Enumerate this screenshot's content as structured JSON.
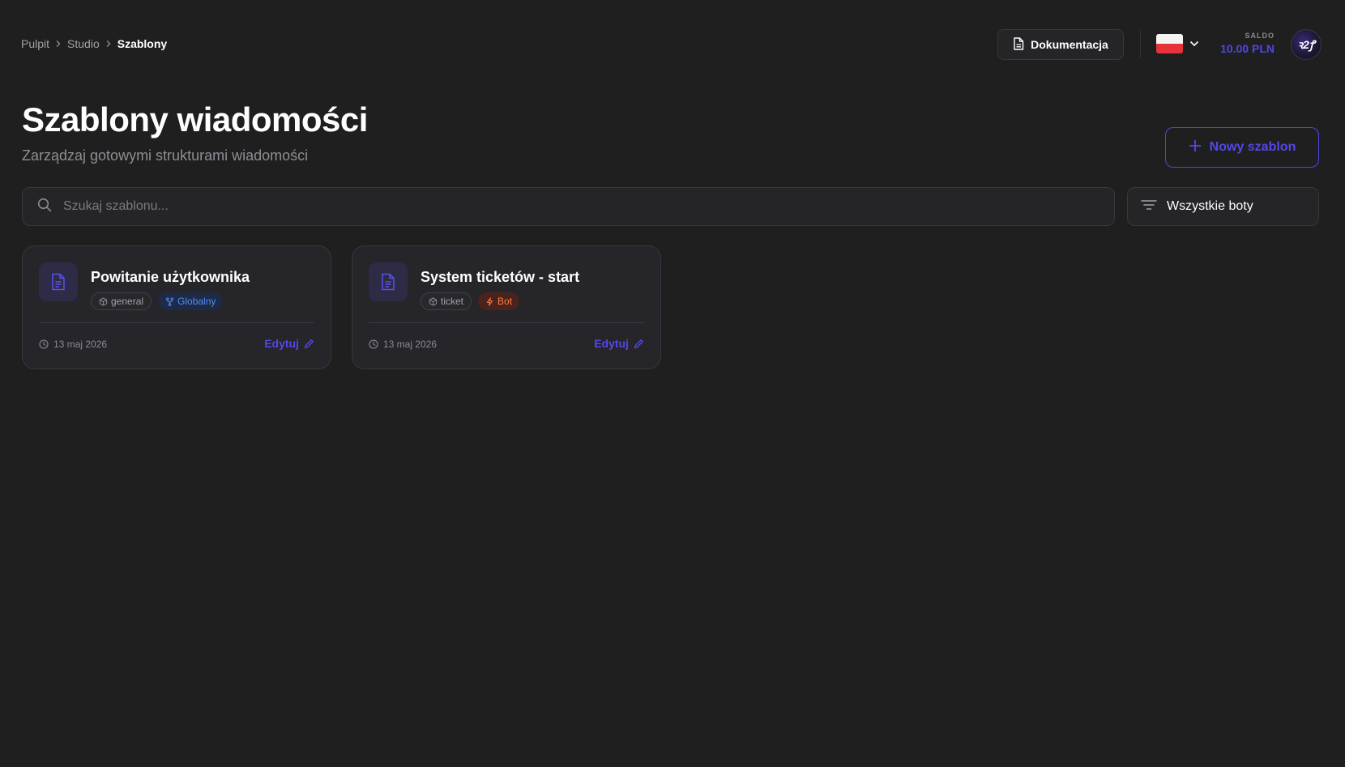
{
  "breadcrumb": {
    "items": [
      "Pulpit",
      "Studio"
    ],
    "current": "Szablony"
  },
  "header": {
    "docs_label": "Dokumentacja",
    "language": "pl",
    "balance_label": "SALDO",
    "balance_value": "10.00 PLN",
    "avatar_text": "ꝛ2ꝭ"
  },
  "page": {
    "title": "Szablony wiadomości",
    "subtitle": "Zarządzaj gotowymi strukturami wiadomości",
    "new_button_label": "Nowy szablon"
  },
  "search": {
    "placeholder": "Szukaj szablonu...",
    "value": ""
  },
  "filter": {
    "selected": "Wszystkie boty"
  },
  "templates": [
    {
      "title": "Powitanie użytkownika",
      "tags": [
        {
          "label": "general",
          "icon": "cube-icon",
          "style": "gray"
        },
        {
          "label": "Globalny",
          "icon": "branch-icon",
          "style": "blue"
        }
      ],
      "date": "13 maj 2026",
      "edit_label": "Edytuj"
    },
    {
      "title": "System ticketów - start",
      "tags": [
        {
          "label": "ticket",
          "icon": "cube-icon",
          "style": "gray"
        },
        {
          "label": "Bot",
          "icon": "bolt-icon",
          "style": "orange"
        }
      ],
      "date": "13 maj 2026",
      "edit_label": "Edytuj"
    }
  ],
  "colors": {
    "background": "#1f1f1f",
    "accent": "#5248e8",
    "surface": "#252528",
    "tag_blue": "#4f8ef7",
    "tag_orange": "#ff7a45"
  }
}
